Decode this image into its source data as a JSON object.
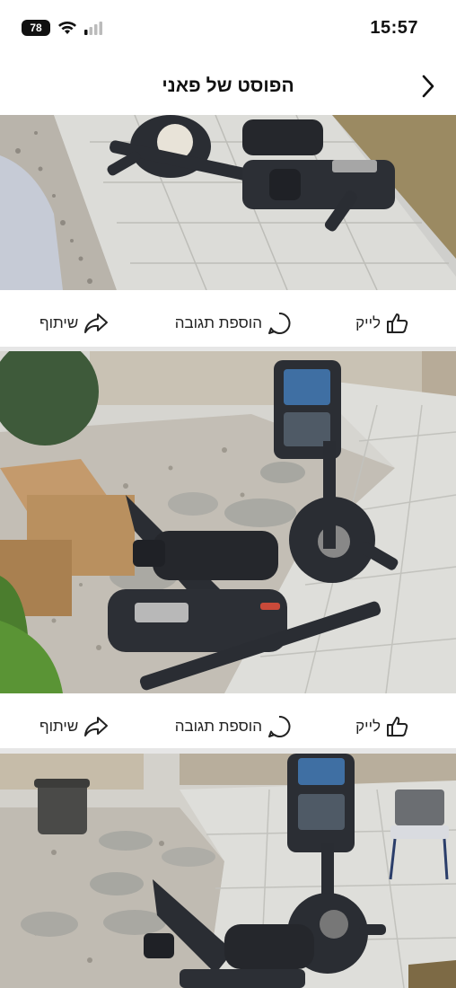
{
  "status_bar": {
    "time": "15:57",
    "battery": "78",
    "icons": [
      "battery-icon",
      "wifi-icon",
      "signal-icon"
    ]
  },
  "header": {
    "title": "הפוסט של פאני",
    "back_icon": "chevron-right-icon"
  },
  "photos": [
    {
      "alt": "recumbent-exercise-bike-photo-1"
    },
    {
      "alt": "recumbent-exercise-bike-photo-2"
    },
    {
      "alt": "recumbent-exercise-bike-photo-3"
    }
  ],
  "actions": {
    "like_label": "לייק",
    "comment_label": "הוספת תגובה",
    "share_label": "שיתוף",
    "like_icon": "thumbs-up-icon",
    "comment_icon": "comment-bubble-icon",
    "share_icon": "share-arrow-icon"
  },
  "colors": {
    "background": "#ffffff",
    "divider": "#e6e6e6",
    "text": "#222222"
  }
}
